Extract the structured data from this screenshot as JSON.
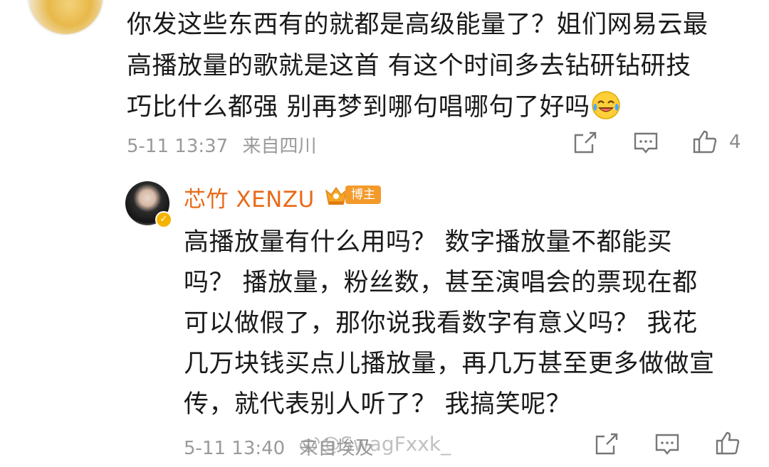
{
  "comment": {
    "lines": [
      "你发这些东西有的就都是高级能量了？姐们网易云最",
      "高播放量的歌就是这首 有这个时间多去钻研钻研技",
      "巧比什么都强 别再梦到哪句唱哪句了好吗"
    ],
    "emoji": "laughing-crying-emoji",
    "time": "5-11 13:37",
    "location": "来自四川",
    "like_count": "4"
  },
  "reply": {
    "author": "芯竹 XENZU",
    "badge": "博主",
    "lines": [
      "高播放量有什么用吗？ 数字播放量不都能买",
      "吗？ 播放量，粉丝数，甚至演唱会的票现在都",
      "可以做假了，那你说我看数字有意义吗？ 我花",
      "几万块钱买点儿播放量，再几万甚至更多做做宣",
      "传，就代表别人听了？ 我搞笑呢？"
    ],
    "time": "5-11 13:40",
    "location": "来自埃及"
  },
  "watermark": "@SwagFxxk_",
  "colors": {
    "text": "#1a1a1a",
    "meta": "#9a9a9a",
    "author": "#e86b1a",
    "badge": "#f39a2b"
  }
}
